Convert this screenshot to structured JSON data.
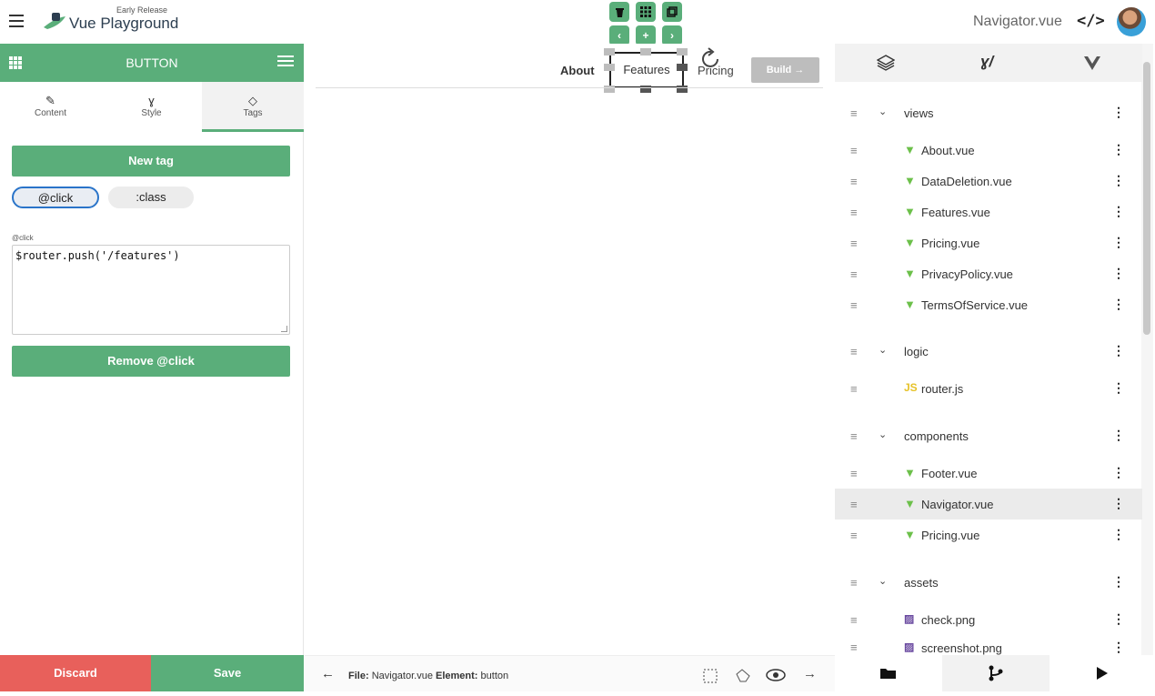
{
  "header": {
    "logo_early": "Early Release",
    "logo_text": "Vue Playground",
    "current_file": "Navigator.vue",
    "code_icon": "</>"
  },
  "floating_controls": {
    "delete_icon": "trash-icon",
    "grid_icon": "grid-icon",
    "duplicate_icon": "copy-icon",
    "left": "‹",
    "add": "+",
    "right": "›"
  },
  "left_panel": {
    "title": "BUTTON",
    "tabs": [
      {
        "label": "Content",
        "icon": "✎"
      },
      {
        "label": "Style",
        "icon": "ɣ"
      },
      {
        "label": "Tags",
        "icon": "◇"
      }
    ],
    "new_tag_label": "New tag",
    "tags": [
      "@click",
      ":class"
    ],
    "selected_tag_label": "@click",
    "tag_value": "$router.push('/features')",
    "remove_label": "Remove @click"
  },
  "footer_left": {
    "discard": "Discard",
    "save": "Save"
  },
  "canvas": {
    "nav_about": "About",
    "nav_features": "Features",
    "nav_pricing": "Pricing",
    "build_label": "Build →"
  },
  "status_bar": {
    "file_label": "File:",
    "file_value": "Navigator.vue",
    "element_label": "Element:",
    "element_value": "button"
  },
  "file_tree": {
    "folders": [
      {
        "name": "views",
        "files": [
          "About.vue",
          "DataDeletion.vue",
          "Features.vue",
          "Pricing.vue",
          "PrivacyPolicy.vue",
          "TermsOfService.vue"
        ]
      },
      {
        "name": "logic",
        "files": [
          "router.js"
        ]
      },
      {
        "name": "components",
        "files": [
          "Footer.vue",
          "Navigator.vue",
          "Pricing.vue"
        ]
      },
      {
        "name": "assets",
        "files": [
          "check.png",
          "screenshot.png"
        ]
      }
    ],
    "active_file": "Navigator.vue"
  },
  "colors": {
    "accent": "#5aae7a",
    "discard": "#e8605b",
    "vue": "#6cc04a",
    "selection": "#2a74c9"
  }
}
